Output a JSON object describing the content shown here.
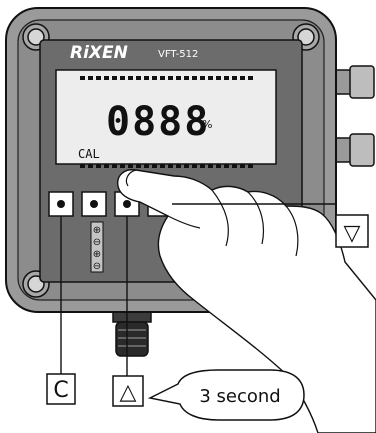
{
  "device": {
    "brand": "RiXEN",
    "model": "VFT-512",
    "display": {
      "digits": "0888",
      "unit": "%",
      "mode": "CAL"
    }
  },
  "keys": [
    "C",
    "△",
    "▽"
  ],
  "callout": "3 second",
  "colors": {
    "housing": "#9a9a9a",
    "panel": "#6c6c6c",
    "lcd": "#ededed",
    "ink": "#111111"
  }
}
